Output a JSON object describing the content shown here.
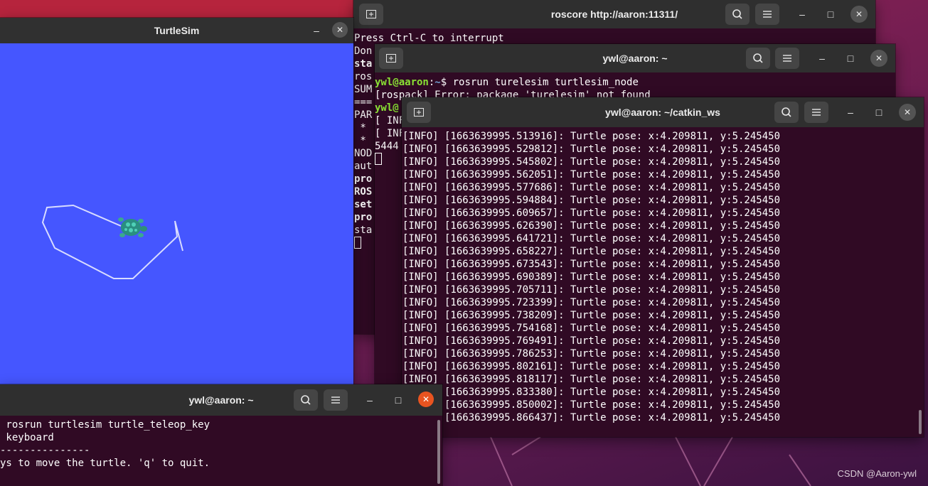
{
  "colors": {
    "terminal_bg": "#300a24",
    "titlebar_bg": "#2f2f2f",
    "turtlesim_bg": "#4556ff",
    "prompt_green": "#8ae234",
    "prompt_blue": "#729fcf",
    "close_active": "#e95420"
  },
  "icons": {
    "new_tab": "new-tab-icon",
    "search": "search-icon",
    "menu": "hamburger-menu-icon",
    "minimize": "minimize-icon",
    "maximize": "maximize-icon",
    "close": "close-icon",
    "turtle": "turtle-icon"
  },
  "roscore": {
    "title": "roscore http://aaron:11311/",
    "lines": [
      "Press Ctrl-C to interrupt",
      "Don",
      "",
      "sta",
      "ros",
      "",
      "",
      "SUM",
      "===",
      "",
      "PAR",
      " *",
      " *",
      "",
      "NOD",
      "",
      "aut",
      "pro",
      "ROS",
      "",
      "set",
      "pro",
      "sta"
    ]
  },
  "turtlesim": {
    "title": "TurtleSim"
  },
  "middle_terminal": {
    "title": "ywl@aaron: ~",
    "prompt_user": "ywl@aaron",
    "prompt_path": "~",
    "command": "$ rosrun turelesim turtlesim_node",
    "lines": [
      "[rospack] Error: package 'turelesim' not found",
      "ywl@",
      "[ INF",
      "[ INF",
      "5444"
    ]
  },
  "catkin_terminal": {
    "title": "ywl@aaron: ~/catkin_ws",
    "lines": [
      "[INFO] [1663639995.513916]: Turtle pose: x:4.209811, y:5.245450",
      "[INFO] [1663639995.529812]: Turtle pose: x:4.209811, y:5.245450",
      "[INFO] [1663639995.545802]: Turtle pose: x:4.209811, y:5.245450",
      "[INFO] [1663639995.562051]: Turtle pose: x:4.209811, y:5.245450",
      "[INFO] [1663639995.577686]: Turtle pose: x:4.209811, y:5.245450",
      "[INFO] [1663639995.594884]: Turtle pose: x:4.209811, y:5.245450",
      "[INFO] [1663639995.609657]: Turtle pose: x:4.209811, y:5.245450",
      "[INFO] [1663639995.626390]: Turtle pose: x:4.209811, y:5.245450",
      "[INFO] [1663639995.641721]: Turtle pose: x:4.209811, y:5.245450",
      "[INFO] [1663639995.658227]: Turtle pose: x:4.209811, y:5.245450",
      "[INFO] [1663639995.673543]: Turtle pose: x:4.209811, y:5.245450",
      "[INFO] [1663639995.690389]: Turtle pose: x:4.209811, y:5.245450",
      "[INFO] [1663639995.705711]: Turtle pose: x:4.209811, y:5.245450",
      "[INFO] [1663639995.723399]: Turtle pose: x:4.209811, y:5.245450",
      "[INFO] [1663639995.738209]: Turtle pose: x:4.209811, y:5.245450",
      "[INFO] [1663639995.754168]: Turtle pose: x:4.209811, y:5.245450",
      "[INFO] [1663639995.769491]: Turtle pose: x:4.209811, y:5.245450",
      "[INFO] [1663639995.786253]: Turtle pose: x:4.209811, y:5.245450",
      "[INFO] [1663639995.802161]: Turtle pose: x:4.209811, y:5.245450",
      "[INFO] [1663639995.818117]: Turtle pose: x:4.209811, y:5.245450",
      "[INFO] [1663639995.833380]: Turtle pose: x:4.209811, y:5.245450",
      "[INFO] [1663639995.850002]: Turtle pose: x:4.209811, y:5.245450",
      "[INFO] [1663639995.866437]: Turtle pose: x:4.209811, y:5.245450"
    ]
  },
  "teleop_terminal": {
    "title": "ywl@aaron: ~",
    "lines": [
      " rosrun turtlesim turtle_teleop_key",
      " keyboard",
      "---------------",
      "ys to move the turtle. 'q' to quit."
    ]
  },
  "watermark": "CSDN @Aaron-ywl"
}
